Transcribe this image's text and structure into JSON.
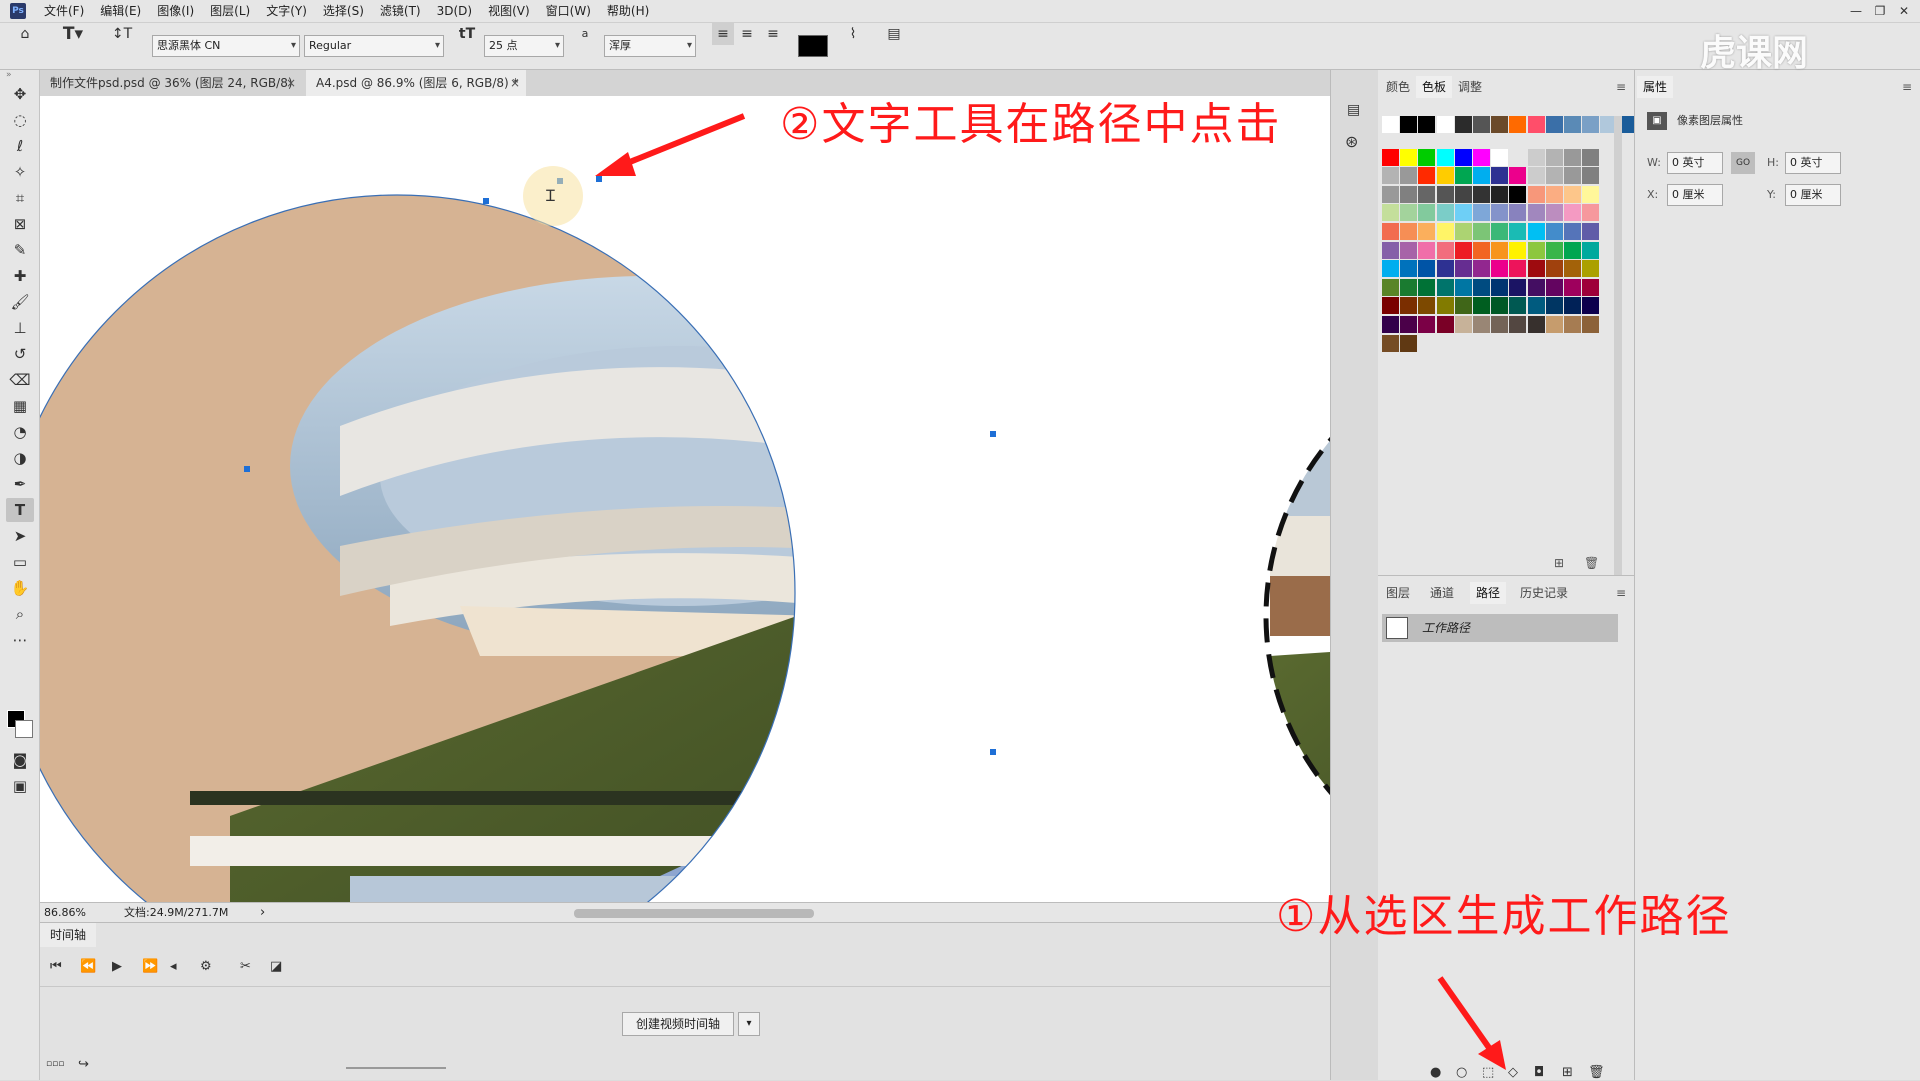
{
  "menu": {
    "items": [
      "文件(F)",
      "编辑(E)",
      "图像(I)",
      "图层(L)",
      "文字(Y)",
      "选择(S)",
      "滤镜(T)",
      "3D(D)",
      "视图(V)",
      "窗口(W)",
      "帮助(H)"
    ],
    "logo": "Ps"
  },
  "options": {
    "font_family": "思源黑体 CN",
    "font_style": "Regular",
    "font_size": "25 点",
    "aa_label": "a",
    "antialias": "浑厚",
    "text_color": "#000000"
  },
  "tabs": [
    {
      "label": "制作文件psd.psd @ 36% (图层 24, RGB/8)",
      "close": "×"
    },
    {
      "label": "A4.psd @ 86.9% (图层 6, RGB/8) *",
      "close": "×"
    }
  ],
  "status": {
    "zoom": "86.86%",
    "doc": "文档:24.9M/271.7M",
    "arrow": "›"
  },
  "timeline": {
    "title": "时间轴",
    "create_button": "创建视频时间轴"
  },
  "swatch_panel": {
    "tabs": [
      "颜色",
      "色板",
      "调整"
    ],
    "active_tab": "色板"
  },
  "path_panel": {
    "tabs": [
      "图层",
      "通道",
      "路径",
      "历史记录"
    ],
    "active_tab": "路径",
    "row_label": "工作路径"
  },
  "properties": {
    "title": "属性",
    "subtitle": "像素图层属性",
    "w_label": "W:",
    "w": "0 英寸",
    "h_label": "H:",
    "h": "0 英寸",
    "x_label": "X:",
    "x": "0 厘米",
    "y_label": "Y:",
    "y": "0 厘米",
    "link_label": "GO"
  },
  "annotations": {
    "step2": "②文字工具在路径中点击",
    "step1": "①从选区生成工作路径"
  },
  "watermark": "虎课网",
  "colors": {
    "annotation": "#ff1a1a",
    "accent_path": "#1e6fd6",
    "beige": "#d6b393",
    "grass": "#4d5a2a"
  },
  "icons": {
    "home": "home-icon",
    "type_tool": "type-tool-icon",
    "move": "move-tool-icon"
  }
}
